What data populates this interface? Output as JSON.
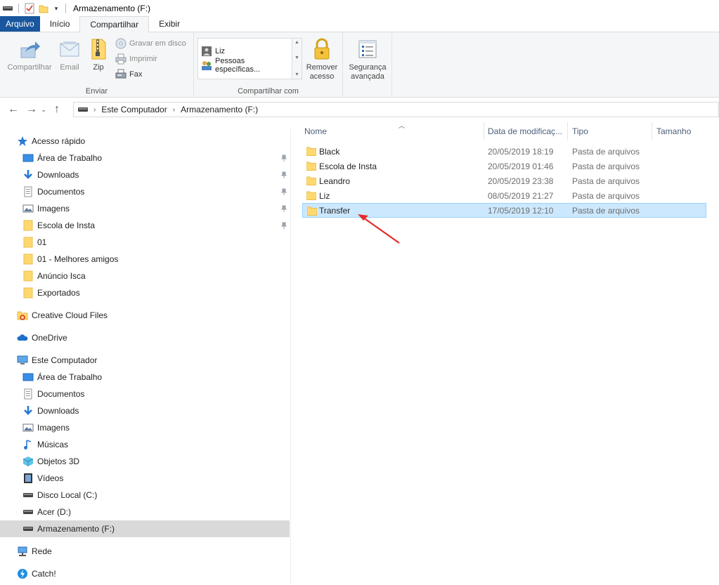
{
  "window": {
    "title": "Armazenamento (F:)"
  },
  "tabs": [
    {
      "label": "Arquivo"
    },
    {
      "label": "Início"
    },
    {
      "label": "Compartilhar"
    },
    {
      "label": "Exibir"
    }
  ],
  "ribbon": {
    "enviar": {
      "label": "Enviar",
      "compartilhar": "Compartilhar",
      "email": "Email",
      "zip": "Zip",
      "gravar": "Gravar em disco",
      "imprimir": "Imprimir",
      "fax": "Fax"
    },
    "compartilhar_com": {
      "label": "Compartilhar com",
      "liz": "Liz",
      "pessoas": "Pessoas específicas...",
      "remover_1": "Remover",
      "remover_2": "acesso"
    },
    "seguranca": {
      "line1": "Segurança",
      "line2": "avançada"
    }
  },
  "address": {
    "crumbs": [
      "Este Computador",
      "Armazenamento (F:)"
    ]
  },
  "nav": {
    "quick_access": "Acesso rápido",
    "quick_items": [
      {
        "label": "Área de Trabalho",
        "icon": "desktop-icon"
      },
      {
        "label": "Downloads",
        "icon": "download-icon"
      },
      {
        "label": "Documentos",
        "icon": "document-icon"
      },
      {
        "label": "Imagens",
        "icon": "pictures-icon"
      },
      {
        "label": "Escola de Insta",
        "icon": "folder-icon"
      },
      {
        "label": "01",
        "icon": "folder-icon"
      },
      {
        "label": "01 - Melhores amigos",
        "icon": "folder-icon"
      },
      {
        "label": "Anúncio Isca",
        "icon": "folder-icon"
      },
      {
        "label": "Exportados",
        "icon": "folder-icon"
      }
    ],
    "creative_cloud": "Creative Cloud Files",
    "onedrive": "OneDrive",
    "este_computador": "Este Computador",
    "pc_items": [
      {
        "label": "Área de Trabalho",
        "icon": "desktop-icon"
      },
      {
        "label": "Documentos",
        "icon": "document-icon"
      },
      {
        "label": "Downloads",
        "icon": "download-icon"
      },
      {
        "label": "Imagens",
        "icon": "pictures-icon"
      },
      {
        "label": "Músicas",
        "icon": "music-icon"
      },
      {
        "label": "Objetos 3D",
        "icon": "cube-icon"
      },
      {
        "label": "Vídeos",
        "icon": "video-icon"
      },
      {
        "label": "Disco Local (C:)",
        "icon": "drive-icon"
      },
      {
        "label": "Acer (D:)",
        "icon": "drive-icon"
      },
      {
        "label": "Armazenamento (F:)",
        "icon": "drive-icon"
      }
    ],
    "rede": "Rede",
    "catch": "Catch!"
  },
  "columns": {
    "name": "Nome",
    "date": "Data de modificaç...",
    "type": "Tipo",
    "size": "Tamanho"
  },
  "files": [
    {
      "name": "Black",
      "date": "20/05/2019 18:19",
      "type": "Pasta de arquivos"
    },
    {
      "name": "Escola de Insta",
      "date": "20/05/2019 01:46",
      "type": "Pasta de arquivos"
    },
    {
      "name": "Leandro",
      "date": "20/05/2019 23:38",
      "type": "Pasta de arquivos"
    },
    {
      "name": "Liz",
      "date": "08/05/2019 21:27",
      "type": "Pasta de arquivos"
    },
    {
      "name": "Transfer",
      "date": "17/05/2019 12:10",
      "type": "Pasta de arquivos"
    }
  ],
  "colors": {
    "accent": "#19569e",
    "selection": "#cce8ff",
    "folder": "#ffd970",
    "annotation": "#e32b2b"
  }
}
